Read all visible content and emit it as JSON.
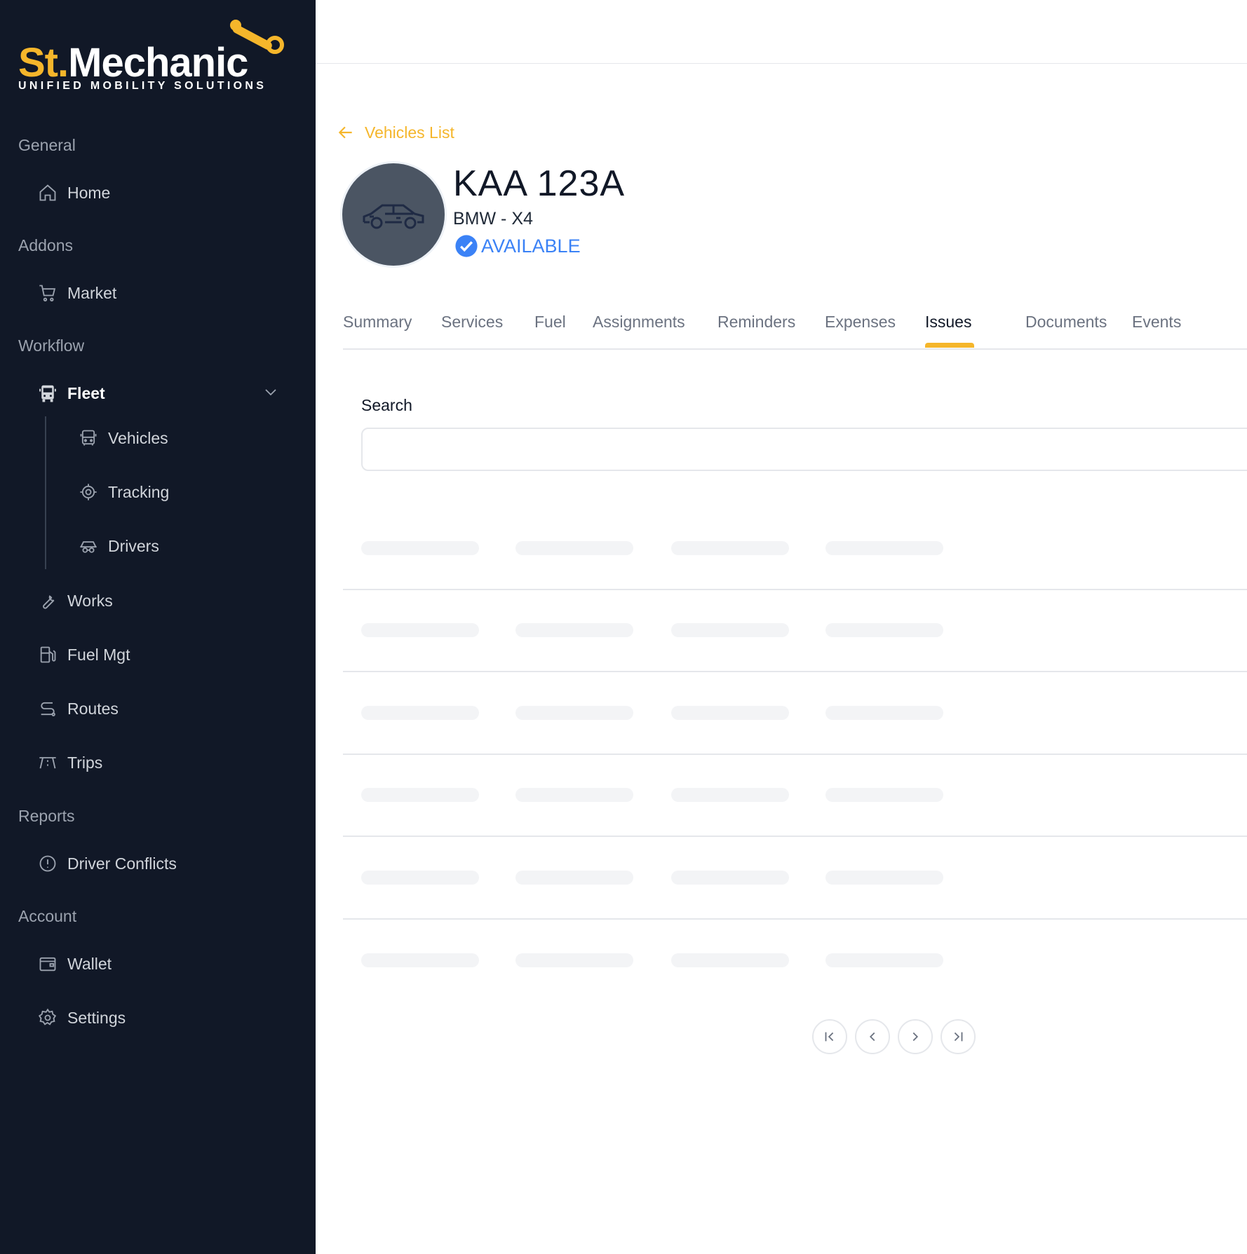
{
  "brand": {
    "name_part1": "St.",
    "name_part2": "Mechanic",
    "tagline": "UNIFIED MOBILITY SOLUTIONS",
    "accent_color": "#f5b62b",
    "sidebar_color": "#111827"
  },
  "sidebar": {
    "sections": {
      "general": "General",
      "addons": "Addons",
      "workflow": "Workflow",
      "reports": "Reports",
      "account": "Account"
    },
    "items": {
      "home": {
        "label": "Home",
        "icon": "home-icon"
      },
      "market": {
        "label": "Market",
        "icon": "cart-icon"
      },
      "fleet": {
        "label": "Fleet",
        "icon": "bus-icon"
      },
      "vehicles": {
        "label": "Vehicles",
        "icon": "bus-icon"
      },
      "tracking": {
        "label": "Tracking",
        "icon": "target-icon"
      },
      "drivers": {
        "label": "Drivers",
        "icon": "driver-icon"
      },
      "works": {
        "label": "Works",
        "icon": "wrench-icon"
      },
      "fuel_mgt": {
        "label": "Fuel Mgt",
        "icon": "fuel-pump-icon"
      },
      "routes": {
        "label": "Routes",
        "icon": "route-icon"
      },
      "trips": {
        "label": "Trips",
        "icon": "road-icon"
      },
      "driver_conflicts": {
        "label": "Driver Conflicts",
        "icon": "alert-circle-icon"
      },
      "wallet": {
        "label": "Wallet",
        "icon": "wallet-icon"
      },
      "settings": {
        "label": "Settings",
        "icon": "gear-icon"
      }
    }
  },
  "header": {
    "back_label": "Vehicles List"
  },
  "vehicle": {
    "plate": "KAA 123A",
    "model": "BMW - X4",
    "status": "AVAILABLE",
    "status_color": "#3b82f6"
  },
  "tabs": [
    "Summary",
    "Services",
    "Fuel",
    "Assignments",
    "Reminders",
    "Expenses",
    "Issues",
    "Documents",
    "Events"
  ],
  "active_tab": "Issues",
  "search": {
    "label": "Search",
    "value": "",
    "placeholder": ""
  }
}
